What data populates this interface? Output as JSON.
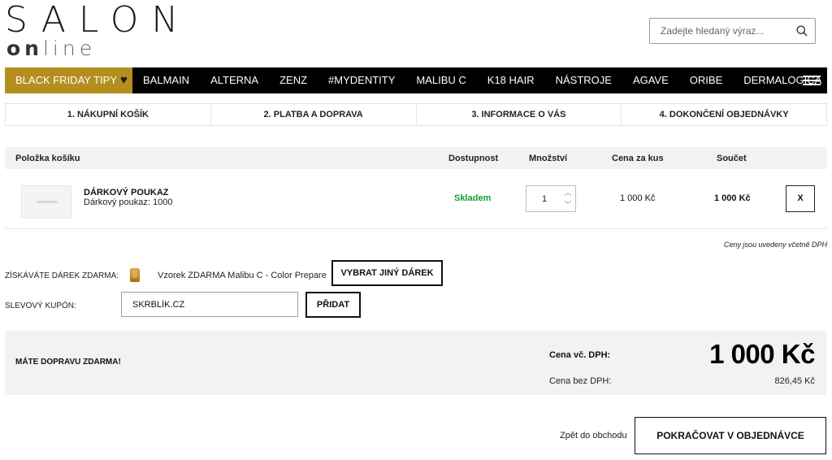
{
  "header": {
    "logo_top": "SALON",
    "logo_bottom_bold": "on",
    "logo_bottom_light": "line",
    "search_placeholder": "Zadejte hledaný výraz...",
    "search_icon": "search-icon"
  },
  "nav": {
    "items": [
      {
        "label": "BLACK FRIDAY TIPY",
        "icon": "black-heart-icon"
      },
      {
        "label": "BALMAIN"
      },
      {
        "label": "ALTERNA"
      },
      {
        "label": "ZENZ"
      },
      {
        "label": "#MYDENTITY"
      },
      {
        "label": "MALIBU C"
      },
      {
        "label": "K18 HAIR"
      },
      {
        "label": "NÁSTROJE"
      },
      {
        "label": "AGAVE"
      },
      {
        "label": "ORIBE"
      },
      {
        "label": "DERMALOGICA"
      }
    ],
    "menu_icon": "hamburger-menu-icon"
  },
  "steps": [
    {
      "label": "1. NÁKUPNÍ KOŠÍK"
    },
    {
      "label": "2. PLATBA A DOPRAVA"
    },
    {
      "label": "3. INFORMACE O VÁS"
    },
    {
      "label": "4. DOKONČENÍ OBJEDNÁVKY"
    }
  ],
  "cart": {
    "headers": {
      "item": "Položka košíku",
      "availability": "Dostupnost",
      "quantity": "Množství",
      "unit_price": "Cena za kus",
      "total": "Součet"
    },
    "rows": [
      {
        "name": "DÁRKOVÝ POUKAZ",
        "subtitle": "Dárkový poukaz: 1000",
        "availability": "Skladem",
        "quantity": "1",
        "unit_price": "1 000 Kč",
        "total": "1 000 Kč",
        "remove_label": "X"
      }
    ],
    "vat_note": "Ceny jsou uvedeny včetně DPH"
  },
  "gift": {
    "label": "ZÍSKÁVÁTE DÁREK ZDARMA:",
    "item": "Vzorek ZDARMA Malibu C - Color Prepare",
    "button": "VYBRAT JINÝ DÁREK"
  },
  "coupon": {
    "label": "SLEVOVÝ KUPÓN:",
    "value": "SKRBLÍK.CZ",
    "button": "PŘIDAT"
  },
  "summary": {
    "free_shipping": "MÁTE DOPRAVU ZDARMA!",
    "price_with_vat_label": "Cena vč. DPH:",
    "price_with_vat": "1 000 Kč",
    "price_without_vat_label": "Cena bez DPH:",
    "price_without_vat": "826,45 Kč"
  },
  "footer": {
    "back_link": "Zpět do obchodu",
    "continue_button": "POKRAČOVAT V OBJEDNÁVCE"
  },
  "colors": {
    "featured_nav": "#b48f1e",
    "nav_bg": "#000000",
    "stock_green": "#12a12e",
    "panel_bg": "#f2f2f2"
  }
}
